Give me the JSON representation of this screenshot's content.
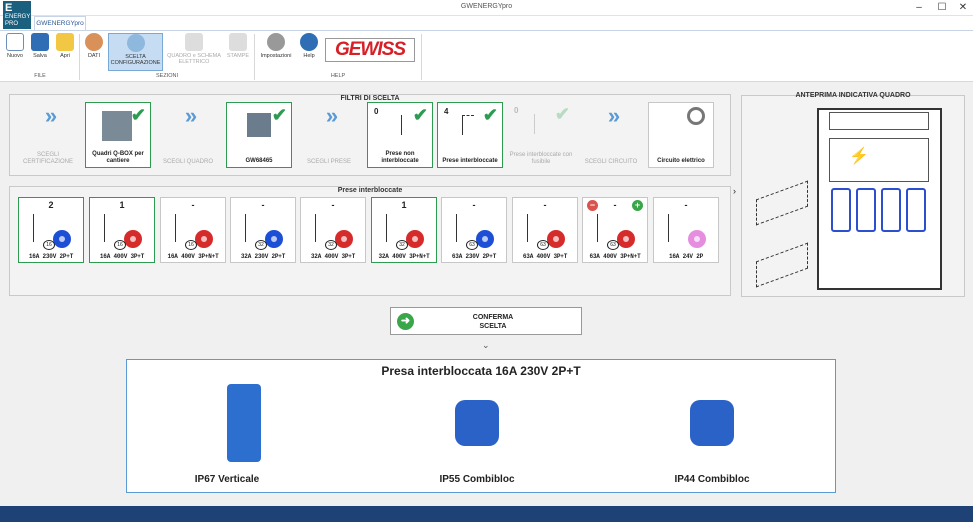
{
  "window": {
    "title": "GWENERGYpro",
    "minimize": "–",
    "maximize": "☐",
    "close": "✕"
  },
  "app_logo": {
    "big": "E",
    "small": "ENERGY PRO"
  },
  "ribbon": {
    "tab": "GWENERGYpro",
    "buttons": {
      "nuovo": "Nuovo",
      "salva": "Salva",
      "apri": "Apri",
      "dati": "DATI",
      "scelta": "SCELTA CONFIGURAZIONE",
      "quadro": "QUADRO e SCHEMA ELETTRICO",
      "stampe": "STAMPE",
      "impostazioni": "Impostazioni",
      "help": "Help"
    },
    "groups": {
      "file": "FILE",
      "sezioni": "SEZIONI",
      "help": "HELP"
    },
    "brand": "GEWISS"
  },
  "filters": {
    "title": "FILTRI DI SCELTA",
    "steps": [
      {
        "label": "SCEGLI CERTIFICAZIONE"
      },
      {
        "label": "Quadri Q-BOX per cantiere"
      },
      {
        "label": "SCEGLI QUADRO"
      },
      {
        "label": "GW68465"
      },
      {
        "label": "SCEGLI PRESE"
      },
      {
        "label": "Prese non interbloccate",
        "count": "0"
      },
      {
        "label": "Prese interbloccate",
        "count": "4"
      },
      {
        "label": "Prese interbloccate con fusibile",
        "count": "0"
      },
      {
        "label": "SCEGLI CIRCUITO"
      },
      {
        "label": "Circuito elettrico"
      }
    ]
  },
  "sockets": {
    "title": "Prese interbloccate",
    "items": [
      {
        "count": "2",
        "amp": "16",
        "spec": "16A 230V 2P+T",
        "color": "blue"
      },
      {
        "count": "1",
        "amp": "16",
        "spec": "16A 400V 3P+T",
        "color": "red"
      },
      {
        "count": "-",
        "amp": "16",
        "spec": "16A 400V 3P+N+T",
        "color": "red"
      },
      {
        "count": "-",
        "amp": "32",
        "spec": "32A 230V 2P+T",
        "color": "blue"
      },
      {
        "count": "-",
        "amp": "32",
        "spec": "32A 400V 3P+T",
        "color": "red"
      },
      {
        "count": "1",
        "amp": "32",
        "spec": "32A 400V 3P+N+T",
        "color": "red"
      },
      {
        "count": "-",
        "amp": "63",
        "spec": "63A 230V 2P+T",
        "color": "blue"
      },
      {
        "count": "-",
        "amp": "63",
        "spec": "63A 400V 3P+T",
        "color": "red"
      },
      {
        "count": "-",
        "amp": "63",
        "spec": "63A 400V 3P+N+T",
        "color": "red"
      },
      {
        "count": "-",
        "amp": "",
        "spec": "16A 24V 2P",
        "color": "pink"
      }
    ],
    "minus": "−",
    "plus": "+"
  },
  "confirm": {
    "line1": "CONFERMA",
    "line2": "SCELTA",
    "icon": "arrow-right-icon",
    "arrow_glyph": "➜"
  },
  "chevron_down": "⌄",
  "expand_arrow": "›",
  "detail": {
    "title": "Presa interbloccata    16A    230V    2P+T",
    "products": [
      {
        "name": "IP67 Verticale"
      },
      {
        "name": "IP55 Combibloc"
      },
      {
        "name": "IP44 Combibloc"
      }
    ]
  },
  "preview": {
    "title": "ANTEPRIMA INDICATIVA QUADRO"
  },
  "colors": {
    "accent": "#5b9bd5",
    "ok": "#2e9b52",
    "status": "#1e4276",
    "brand": "#d61f26"
  }
}
